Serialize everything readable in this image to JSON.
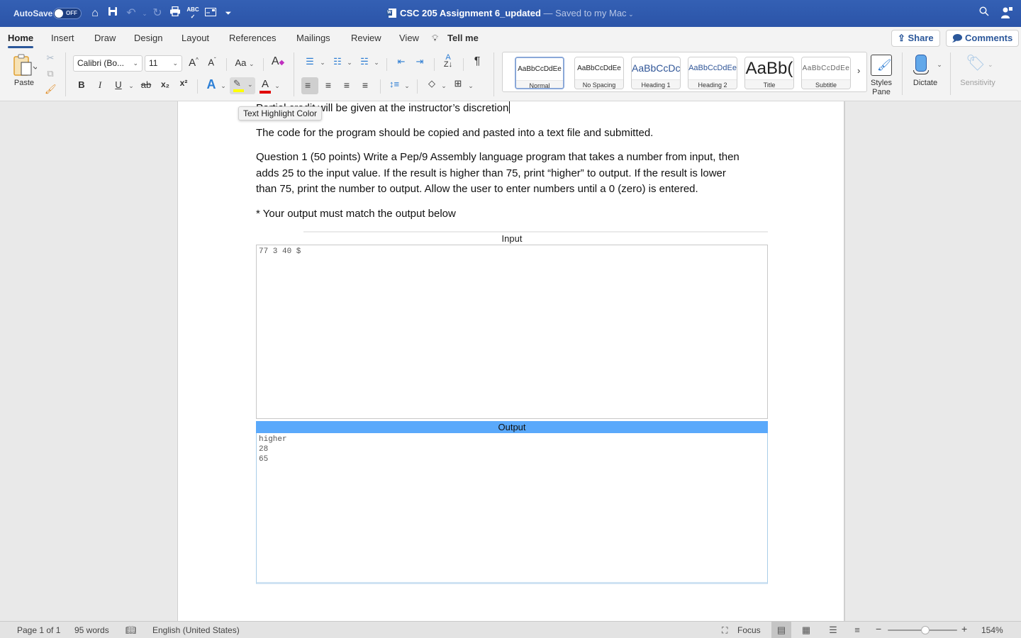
{
  "titlebar": {
    "autosave_label": "AutoSave",
    "autosave_state": "OFF",
    "doc_title": "CSC 205 Assignment 6_updated",
    "saved_status": " — Saved to my Mac",
    "quick_access": [
      "home-icon",
      "save-icon",
      "undo-icon",
      "redo-icon",
      "print-icon",
      "spelling-icon",
      "layout-icon",
      "customize-icon"
    ]
  },
  "tabs": [
    {
      "label": "Home",
      "active": true
    },
    {
      "label": "Insert"
    },
    {
      "label": "Draw"
    },
    {
      "label": "Design"
    },
    {
      "label": "Layout"
    },
    {
      "label": "References"
    },
    {
      "label": "Mailings"
    },
    {
      "label": "Review"
    },
    {
      "label": "View"
    },
    {
      "label": "Tell me"
    }
  ],
  "actions": {
    "share": "Share",
    "comments": "Comments"
  },
  "ribbon": {
    "paste_label": "Paste",
    "font_name": "Calibri (Bo...",
    "font_size": "11",
    "case_label": "Aa",
    "bold": "B",
    "italic": "I",
    "underline": "U",
    "strikethrough": "ab",
    "subscript": "x₂",
    "superscript": "x²",
    "highlight_color": "#ffff00",
    "font_color": "#e00000",
    "styles": [
      {
        "preview": "AaBbCcDdEe",
        "label": "Normal",
        "selected": true
      },
      {
        "preview": "AaBbCcDdEe",
        "label": "No Spacing"
      },
      {
        "preview": "AaBbCcDc",
        "label": "Heading 1"
      },
      {
        "preview": "AaBbCcDdEe",
        "label": "Heading 2"
      },
      {
        "preview": "AaBb(",
        "label": "Title"
      },
      {
        "preview": "AaBbCcDdEe",
        "label": "Subtitle"
      }
    ],
    "styles_pane_label": "Styles Pane",
    "dictate_label": "Dictate",
    "sensitivity_label": "Sensitivity"
  },
  "tooltip": "Text Highlight Color",
  "document": {
    "para1_hidden": "Partial credit",
    "para1": " will be given at the instructor’s discretion",
    "para2": "The code for the program should be copied and pasted into a text file and submitted.",
    "para3_line1": "Question 1 (50 points) Write a Pep/9 Assembly language program that takes a number from input, then",
    "para3_line2": "adds 25 to the input value. If the result is higher than 75, print “higher” to output. If the result is lower",
    "para3_line3": "than 75, print the number to output. Allow the user to enter numbers until a 0 (zero) is entered.",
    "para4": "* Your output must match the output below",
    "pep": {
      "input_header": "Input",
      "input_value": "77 3 40 $",
      "output_header": "Output",
      "output_lines": [
        "higher",
        "28",
        "65"
      ]
    }
  },
  "status": {
    "page": "Page 1 of 1",
    "words": "95 words",
    "language": "English (United States)",
    "focus": "Focus",
    "zoom_level": "154%",
    "zoom_fraction": 0.54
  }
}
